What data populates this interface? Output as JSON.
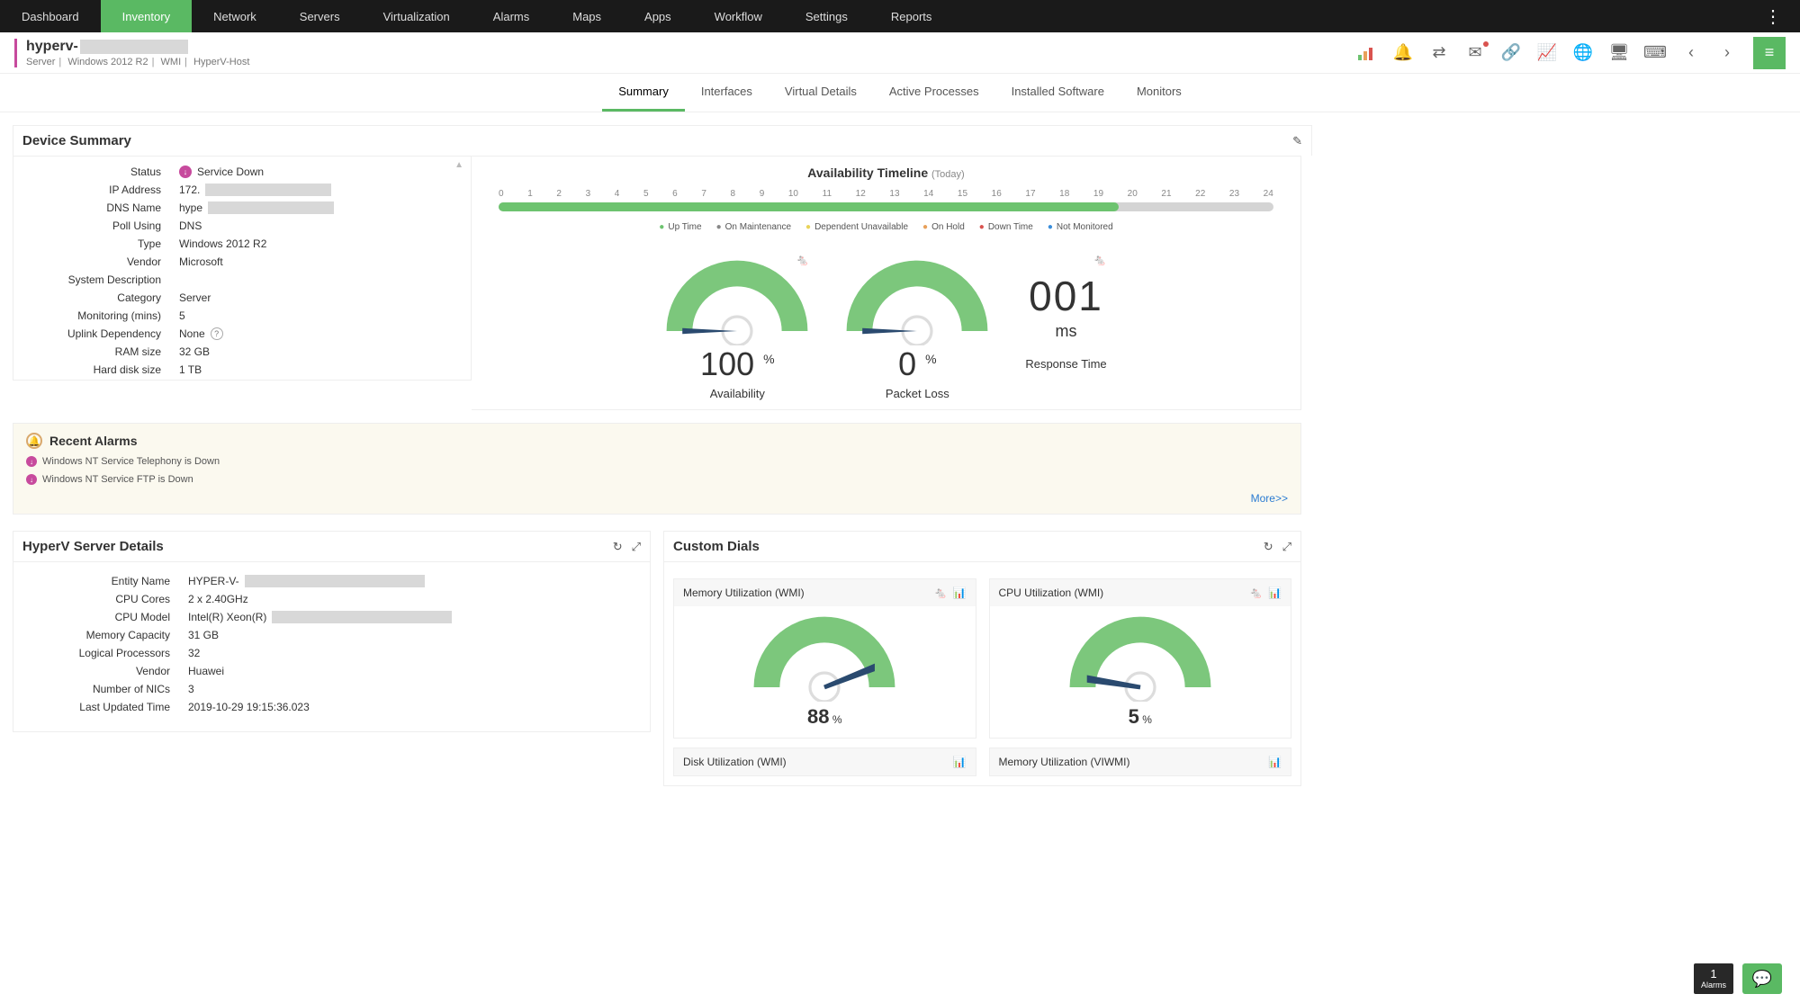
{
  "nav": {
    "items": [
      "Dashboard",
      "Inventory",
      "Network",
      "Servers",
      "Virtualization",
      "Alarms",
      "Maps",
      "Apps",
      "Workflow",
      "Settings",
      "Reports"
    ],
    "active_index": 1
  },
  "host": {
    "title_prefix": "hyperv-",
    "sub_role": "Server",
    "sub_os": "Windows 2012 R2",
    "sub_proto": "WMI",
    "sub_type": "HyperV-Host"
  },
  "tabs": {
    "items": [
      "Summary",
      "Interfaces",
      "Virtual Details",
      "Active Processes",
      "Installed Software",
      "Monitors"
    ],
    "active_index": 0
  },
  "device_summary": {
    "title": "Device Summary",
    "rows": {
      "status_label": "Status",
      "status_value": "Service Down",
      "ip_label": "IP Address",
      "ip_value": "172.",
      "dns_label": "DNS Name",
      "dns_value": "hype",
      "poll_label": "Poll Using",
      "poll_value": "DNS",
      "type_label": "Type",
      "type_value": "Windows 2012 R2",
      "vendor_label": "Vendor",
      "vendor_value": "Microsoft",
      "sysdesc_label": "System Description",
      "sysdesc_value": "",
      "category_label": "Category",
      "category_value": "Server",
      "mon_label": "Monitoring (mins)",
      "mon_value": "5",
      "uplink_label": "Uplink Dependency",
      "uplink_value": "None",
      "ram_label": "RAM size",
      "ram_value": "32 GB",
      "hd_label": "Hard disk size",
      "hd_value": "1 TB"
    }
  },
  "timeline": {
    "title": "Availability Timeline",
    "subtitle": "(Today)",
    "hours": [
      "0",
      "1",
      "2",
      "3",
      "4",
      "5",
      "6",
      "7",
      "8",
      "9",
      "10",
      "11",
      "12",
      "13",
      "14",
      "15",
      "16",
      "17",
      "18",
      "19",
      "20",
      "21",
      "22",
      "23",
      "24"
    ],
    "legend": {
      "up": "Up Time",
      "maint": "On Maintenance",
      "dep": "Dependent Unavailable",
      "hold": "On Hold",
      "down": "Down Time",
      "not": "Not Monitored"
    },
    "fill_percent": 80
  },
  "gauges": {
    "availability_label": "Availability",
    "availability_value": "100",
    "packet_label": "Packet Loss",
    "packet_value": "0",
    "response_label": "Response Time",
    "response_value": "001",
    "response_unit": "ms"
  },
  "alarms": {
    "title": "Recent Alarms",
    "items": [
      "Windows NT Service Telephony is Down",
      "Windows NT Service FTP is Down"
    ],
    "more": "More>>"
  },
  "hyperv": {
    "title": "HyperV Server Details",
    "rows": {
      "entity_label": "Entity Name",
      "entity_value": "HYPER-V-",
      "cores_label": "CPU Cores",
      "cores_value": "2 x 2.40GHz",
      "model_label": "CPU Model",
      "model_value": "Intel(R) Xeon(R)",
      "mem_label": "Memory Capacity",
      "mem_value": "31 GB",
      "lp_label": "Logical Processors",
      "lp_value": "32",
      "vendor_label": "Vendor",
      "vendor_value": "Huawei",
      "nic_label": "Number of NICs",
      "nic_value": "3",
      "updated_label": "Last Updated Time",
      "updated_value": "2019-10-29 19:15:36.023"
    }
  },
  "dials": {
    "title": "Custom Dials",
    "cards": [
      {
        "title": "Memory Utilization (WMI)",
        "value": "88",
        "unit": "%",
        "gauge_pct": 88,
        "show_rat": true
      },
      {
        "title": "CPU Utilization (WMI)",
        "value": "5",
        "unit": "%",
        "gauge_pct": 5,
        "show_rat": true
      },
      {
        "title": "Disk Utilization (WMI)",
        "value": "",
        "unit": "",
        "gauge_pct": 0,
        "show_rat": false
      },
      {
        "title": "Memory Utilization (VIWMI)",
        "value": "",
        "unit": "",
        "gauge_pct": 0,
        "show_rat": false
      }
    ]
  },
  "footer": {
    "alarm_count": "1",
    "alarm_label": "Alarms"
  },
  "chart_data": [
    {
      "type": "bar",
      "title": "Availability Timeline (Today)",
      "categories": [
        "0",
        "1",
        "2",
        "3",
        "4",
        "5",
        "6",
        "7",
        "8",
        "9",
        "10",
        "11",
        "12",
        "13",
        "14",
        "15",
        "16",
        "17",
        "18",
        "19",
        "20",
        "21",
        "22",
        "23",
        "24"
      ],
      "series": [
        {
          "name": "Up Time",
          "values": [
            1,
            1,
            1,
            1,
            1,
            1,
            1,
            1,
            1,
            1,
            1,
            1,
            1,
            1,
            1,
            1,
            1,
            1,
            1,
            1,
            0,
            0,
            0,
            0,
            0
          ]
        }
      ],
      "xlabel": "",
      "ylabel": "",
      "ylim": [
        0,
        1
      ]
    },
    {
      "type": "pie",
      "title": "Availability",
      "values": [
        100
      ],
      "unit": "%"
    },
    {
      "type": "pie",
      "title": "Packet Loss",
      "values": [
        0
      ],
      "unit": "%"
    },
    {
      "type": "pie",
      "title": "Memory Utilization (WMI)",
      "values": [
        88
      ],
      "unit": "%"
    },
    {
      "type": "pie",
      "title": "CPU Utilization (WMI)",
      "values": [
        5
      ],
      "unit": "%"
    }
  ]
}
